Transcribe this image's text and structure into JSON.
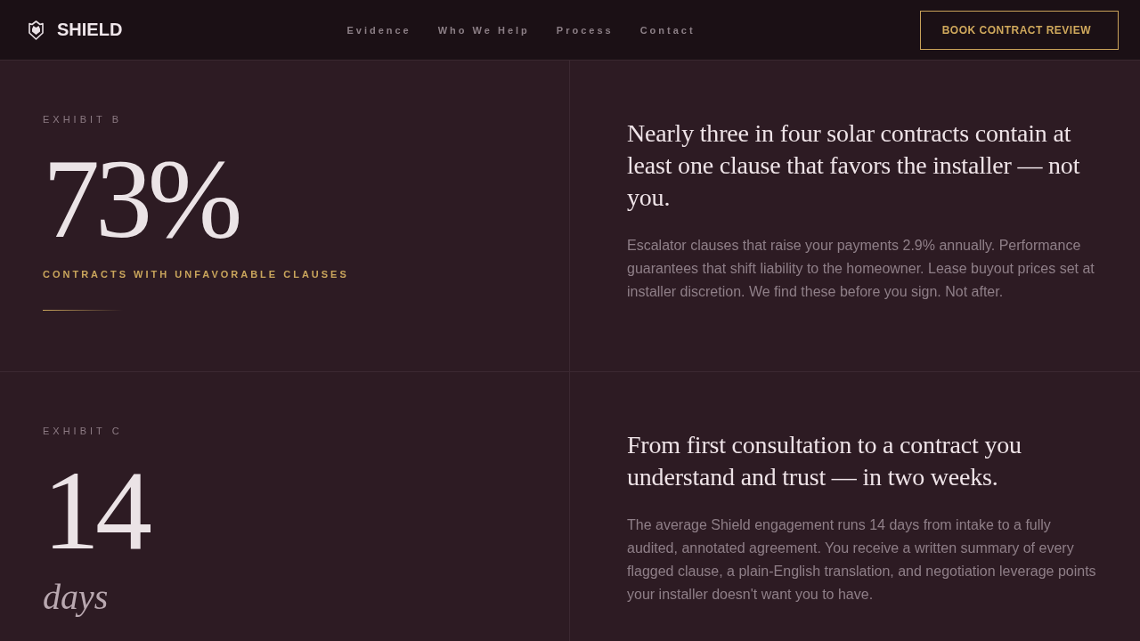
{
  "header": {
    "brand": "SHIELD",
    "nav": [
      {
        "label": "Evidence"
      },
      {
        "label": "Who We Help"
      },
      {
        "label": "Process"
      },
      {
        "label": "Contact"
      }
    ],
    "cta": "BOOK CONTRACT REVIEW"
  },
  "exhibits": [
    {
      "label": "EXHIBIT B",
      "figure": "73%",
      "caption": "CONTRACTS WITH UNFAVORABLE CLAUSES",
      "heading": "Nearly three in four solar contracts contain at least one clause that favors the installer — not you.",
      "body": "Escalator clauses that raise your payments 2.9% annually. Performance guarantees that shift liability to the homeowner. Lease buyout prices set at installer discretion. We find these before you sign. Not after."
    },
    {
      "label": "EXHIBIT C",
      "figure": "14",
      "unit": "days",
      "heading": "From first consultation to a contract you understand and trust — in two weeks.",
      "body": "The average Shield engagement runs 14 days from intake to a fully audited, annotated agreement. You receive a written summary of every flagged clause, a plain-English translation, and negotiation leverage points your installer doesn't want you to have."
    }
  ]
}
